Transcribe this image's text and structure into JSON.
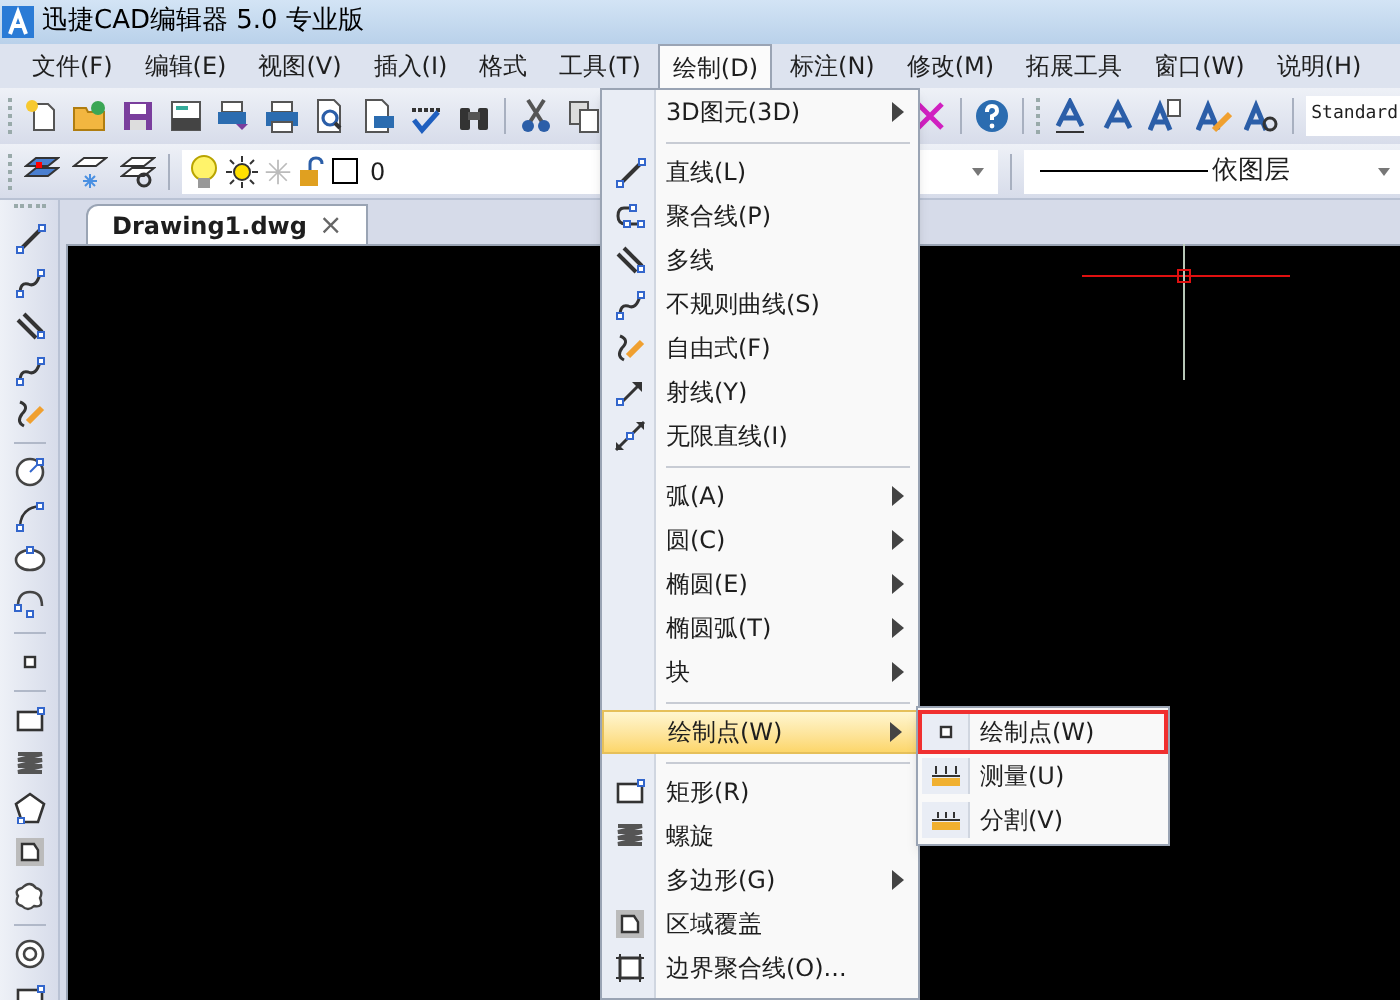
{
  "window": {
    "title": "迅捷CAD编辑器 5.0 专业版"
  },
  "menu_bar": [
    {
      "label": "文件(F)",
      "selected": false
    },
    {
      "label": "编辑(E)",
      "selected": false
    },
    {
      "label": "视图(V)",
      "selected": false
    },
    {
      "label": "插入(I)",
      "selected": false
    },
    {
      "label": "格式",
      "selected": false
    },
    {
      "label": "工具(T)",
      "selected": false
    },
    {
      "label": "绘制(D)",
      "selected": true
    },
    {
      "label": "标注(N)",
      "selected": false
    },
    {
      "label": "修改(M)",
      "selected": false
    },
    {
      "label": "拓展工具",
      "selected": false
    },
    {
      "label": "窗口(W)",
      "selected": false
    },
    {
      "label": "说明(H)",
      "selected": false
    }
  ],
  "text_style": {
    "value": "Standard"
  },
  "layer": {
    "value": "0"
  },
  "linetype": {
    "value": "依图层"
  },
  "document_tab": {
    "label": "Drawing1.dwg",
    "close": "×"
  },
  "draw_menu": [
    {
      "kind": "item",
      "label": "3D图元(3D)",
      "submenu": true,
      "selected": false
    },
    {
      "kind": "separator"
    },
    {
      "kind": "item",
      "label": "直线(L)",
      "submenu": false,
      "selected": false
    },
    {
      "kind": "item",
      "label": "聚合线(P)",
      "submenu": false,
      "selected": false
    },
    {
      "kind": "item",
      "label": "多线",
      "submenu": false,
      "selected": false
    },
    {
      "kind": "item",
      "label": "不规则曲线(S)",
      "submenu": false,
      "selected": false
    },
    {
      "kind": "item",
      "label": "自由式(F)",
      "submenu": false,
      "selected": false
    },
    {
      "kind": "item",
      "label": "射线(Y)",
      "submenu": false,
      "selected": false
    },
    {
      "kind": "item",
      "label": "无限直线(I)",
      "submenu": false,
      "selected": false
    },
    {
      "kind": "separator"
    },
    {
      "kind": "item",
      "label": "弧(A)",
      "submenu": true,
      "selected": false
    },
    {
      "kind": "item",
      "label": "圆(C)",
      "submenu": true,
      "selected": false
    },
    {
      "kind": "item",
      "label": "椭圆(E)",
      "submenu": true,
      "selected": false
    },
    {
      "kind": "item",
      "label": "椭圆弧(T)",
      "submenu": true,
      "selected": false
    },
    {
      "kind": "item",
      "label": "块",
      "submenu": true,
      "selected": false
    },
    {
      "kind": "separator"
    },
    {
      "kind": "item",
      "label": "绘制点(W)",
      "submenu": true,
      "selected": true
    },
    {
      "kind": "separator"
    },
    {
      "kind": "item",
      "label": "矩形(R)",
      "submenu": false,
      "selected": false
    },
    {
      "kind": "item",
      "label": "螺旋",
      "submenu": false,
      "selected": false
    },
    {
      "kind": "item",
      "label": "多边形(G)",
      "submenu": true,
      "selected": false
    },
    {
      "kind": "item",
      "label": "区域覆盖",
      "submenu": false,
      "selected": false
    },
    {
      "kind": "item",
      "label": "边界聚合线(O)...",
      "submenu": false,
      "selected": false
    }
  ],
  "point_submenu": [
    {
      "label": "绘制点(W)",
      "selected": true
    },
    {
      "label": "测量(U)",
      "selected": false
    },
    {
      "label": "分割(V)",
      "selected": false
    }
  ]
}
